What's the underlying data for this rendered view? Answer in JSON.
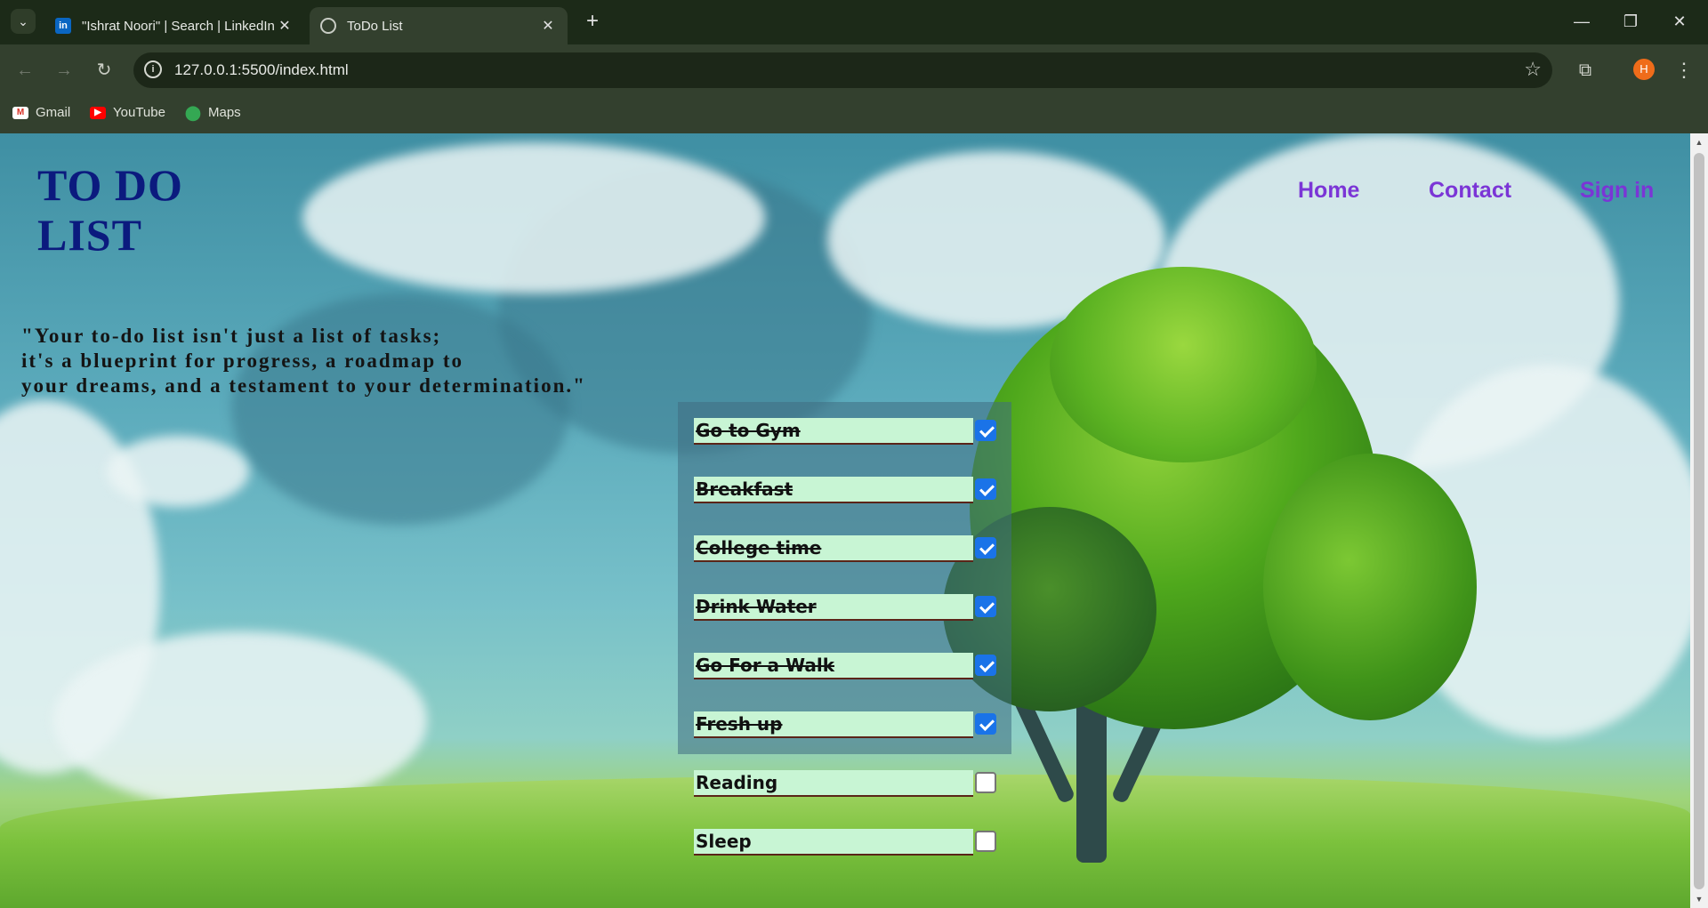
{
  "browser": {
    "tabs": [
      {
        "title": "\"Ishrat Noori\" | Search | LinkedIn",
        "icon": "linkedin-icon",
        "active": false
      },
      {
        "title": "ToDo List",
        "icon": "globe-icon",
        "active": true
      }
    ],
    "url": "127.0.0.1:5500/index.html",
    "profile_initial": "H",
    "bookmarks": [
      {
        "label": "Gmail",
        "icon": "gmail-icon"
      },
      {
        "label": "YouTube",
        "icon": "youtube-icon"
      },
      {
        "label": "Maps",
        "icon": "maps-icon"
      }
    ]
  },
  "page": {
    "logo_line1": "TO DO",
    "logo_line2": "LIST",
    "nav": [
      "Home",
      "Contact",
      "Sign in"
    ],
    "quote_lines": [
      "\"Your to-do list isn't just a list of tasks;",
      "it's a blueprint for progress, a roadmap to",
      "your dreams, and a testament to your determination.\""
    ],
    "todos": [
      {
        "label": "Go to Gym",
        "checked": true
      },
      {
        "label": "Breakfast",
        "checked": true
      },
      {
        "label": "College time",
        "checked": true
      },
      {
        "label": "Drink Water",
        "checked": true
      },
      {
        "label": "Go For a Walk",
        "checked": true
      },
      {
        "label": "Fresh up",
        "checked": true
      },
      {
        "label": "Reading",
        "checked": false
      },
      {
        "label": "Sleep",
        "checked": false
      }
    ]
  },
  "colors": {
    "logo": "#0b1a7e",
    "nav_link": "#7b35d6",
    "task_bg": "#c8f5d4",
    "checkbox_checked": "#1a73e8"
  }
}
